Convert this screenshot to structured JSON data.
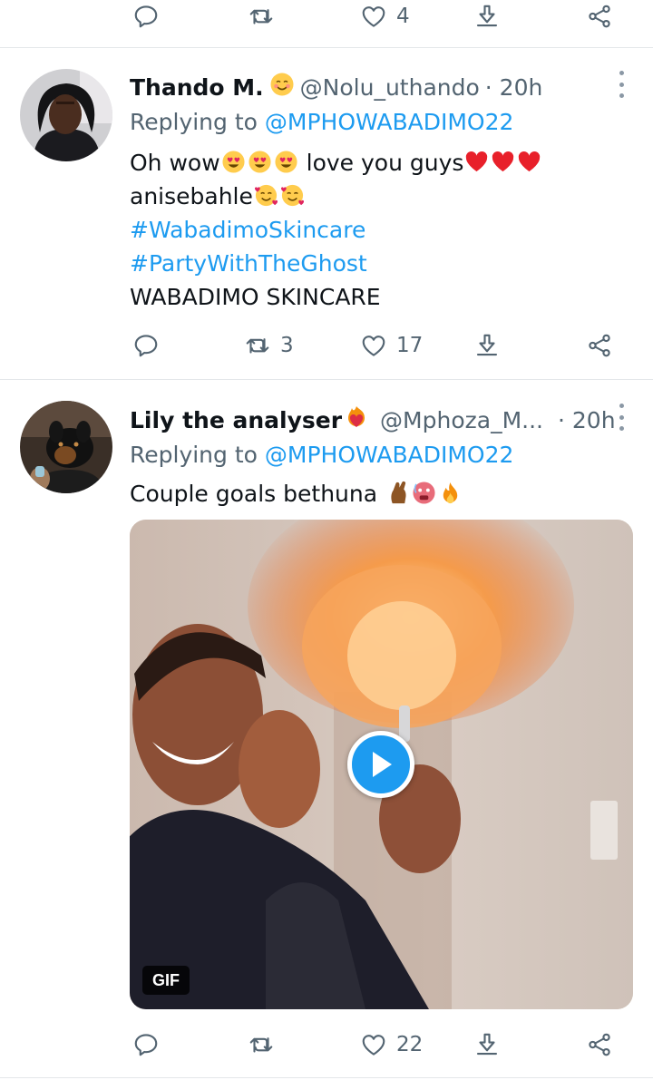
{
  "top_actions": {
    "reply_count": "",
    "retweet_count": "",
    "like_count": "4"
  },
  "tweets": [
    {
      "display_name": "Thando M.",
      "name_emoji": "smiling-face-icon",
      "handle": "@Nolu_uthando",
      "time": "· 20h",
      "reply_prefix": "Replying to",
      "reply_to": "@MPHOWABADIMO22",
      "lines": {
        "l1_a": "Oh wow",
        "l1_b": " love you guys",
        "l2_a": "anisebahle",
        "hashtag1": "#WabadimoSkincare",
        "hashtag2": "#PartyWithTheGhost",
        "l5": "WABADIMO SKINCARE"
      },
      "actions": {
        "reply_count": "",
        "retweet_count": "3",
        "like_count": "17"
      }
    },
    {
      "display_name": "Lily the analyser",
      "name_emoji": "heart-on-fire-icon",
      "handle": "@Mphoza_M...",
      "time": "· 20h",
      "reply_prefix": "Replying to",
      "reply_to": "@MPHOWABADIMO22",
      "text": "Couple goals bethuna ",
      "media_badge": "GIF",
      "actions": {
        "reply_count": "",
        "retweet_count": "",
        "like_count": "22"
      }
    }
  ],
  "colors": {
    "accent": "#1d9bf0",
    "muted": "#536471",
    "heart": "#f4212e",
    "divider": "#e4e7ea"
  }
}
